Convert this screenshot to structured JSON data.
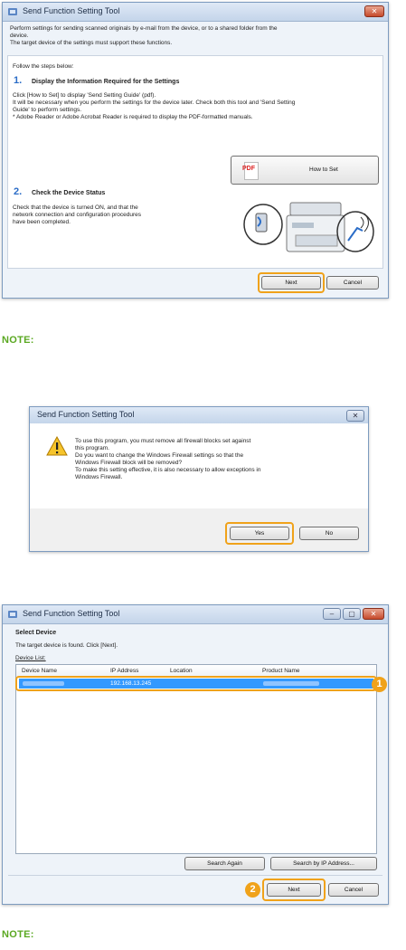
{
  "window1": {
    "title": "Send Function Setting Tool",
    "intro_line1": "Perform settings for sending scanned originals by e-mail from the device, or to a shared folder from the",
    "intro_line2": "device.",
    "intro_line3": "The target device of the settings must support these functions.",
    "follow": "Follow the steps below:",
    "step1_num": "1.",
    "step1_title": "Display the Information Required for the Settings",
    "step1_line1": "Click [How to Set] to display 'Send Setting Guide' (pdf).",
    "step1_line2": "It will be necessary when you perform the settings for the device later. Check both this tool and 'Send Setting",
    "step1_line3": "Guide' to perform settings.",
    "step1_line4": "* Adobe Reader or Adobe Acrobat Reader is required to display the PDF-formatted manuals.",
    "pdf_label": "PDF",
    "how_to_set": "How to Set",
    "step2_num": "2.",
    "step2_title": "Check the Device Status",
    "step2_line1": "Check that the device is turned ON, and that the",
    "step2_line2": "network connection and configuration procedures",
    "step2_line3": "have been completed.",
    "next": "Next",
    "cancel": "Cancel"
  },
  "note1": "NOTE:",
  "dialog": {
    "title": "Send Function Setting Tool",
    "line1": "To use this program, you must remove all firewall blocks set against",
    "line2": "this program.",
    "line3": "Do you want to change the Windows Firewall settings so that the",
    "line4": "Windows Firewall block will be removed?",
    "line5": "To make this setting effective, it is also necessary to allow exceptions in",
    "line6": "Windows Firewall.",
    "yes": "Yes",
    "no": "No"
  },
  "window3": {
    "title": "Send Function Setting Tool",
    "heading": "Select Device",
    "found": "The target device is found. Click [Next].",
    "device_list_label": "Device List:",
    "columns": [
      "Device Name",
      "IP Address",
      "Location",
      "Product Name"
    ],
    "row_ip": "192.168.13.245",
    "search_again": "Search Again",
    "search_by_ip": "Search by IP Address...",
    "next": "Next",
    "cancel": "Cancel",
    "badge1": "1",
    "badge2": "2"
  },
  "note2": "NOTE:",
  "colors": {
    "accent": "#f0a21a",
    "note_green": "#5aa821",
    "selection_blue": "#3399ff",
    "step_blue": "#2a6cc7"
  }
}
